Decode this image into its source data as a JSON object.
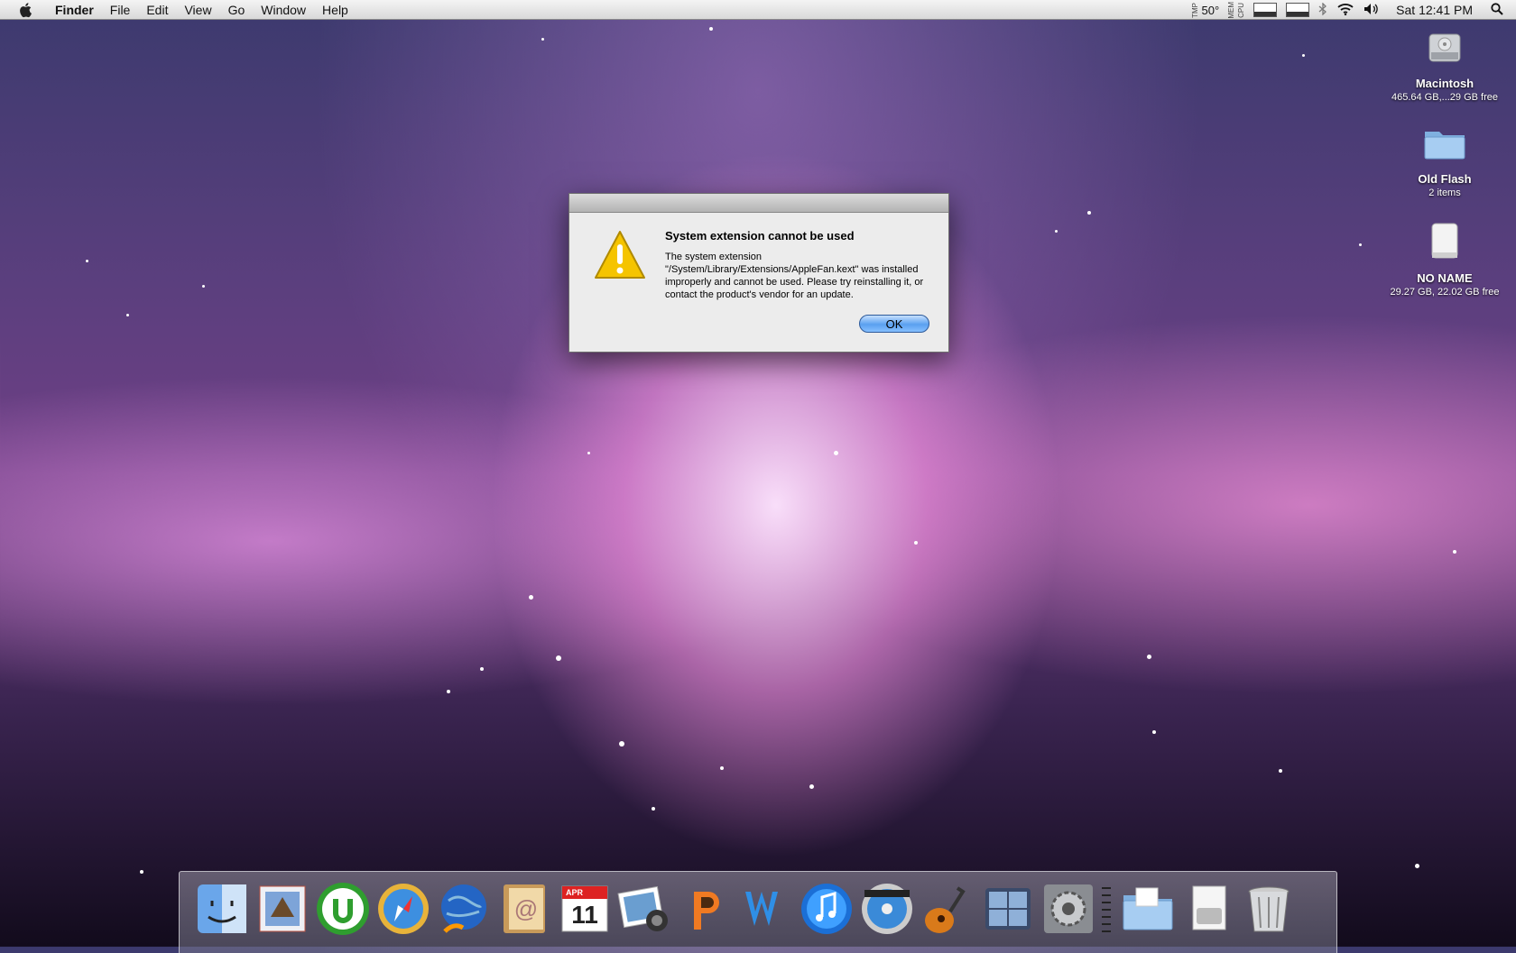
{
  "menubar": {
    "apple_icon": "apple-icon",
    "items": [
      "Finder",
      "File",
      "Edit",
      "View",
      "Go",
      "Window",
      "Help"
    ],
    "status": {
      "temp_label": "TMP",
      "temp_value": "50°",
      "mem_label": "MEM",
      "cpu_label": "CPU",
      "clock": "Sat 12:41 PM"
    }
  },
  "desktop": {
    "icons": [
      {
        "label": "Macintosh",
        "sub": "465.64 GB,...29 GB free",
        "icon": "hard-drive-icon"
      },
      {
        "label": "Old Flash",
        "sub": "2 items",
        "icon": "folder-icon"
      },
      {
        "label": "NO NAME",
        "sub": "29.27 GB, 22.02 GB free",
        "icon": "removable-drive-icon"
      }
    ]
  },
  "dialog": {
    "title": "System extension cannot be used",
    "message": "The system extension \"/System/Library/Extensions/AppleFan.kext\" was installed improperly and cannot be used. Please try reinstalling it, or contact the product's vendor for an update.",
    "ok_label": "OK"
  },
  "dock": {
    "apps": [
      "Finder",
      "Mail",
      "uTorrent",
      "Safari",
      "Camino",
      "Address Book",
      "iCal",
      "iPhoto",
      "PowerPoint",
      "Word",
      "iTunes",
      "DVD Player",
      "GarageBand",
      "Spaces",
      "System Preferences",
      "Documents",
      "Downloads",
      "Trash"
    ],
    "ical_month": "APR",
    "ical_day": "11"
  },
  "colors": {
    "accent": "#5aa0f0",
    "warning": "#f5c400"
  }
}
